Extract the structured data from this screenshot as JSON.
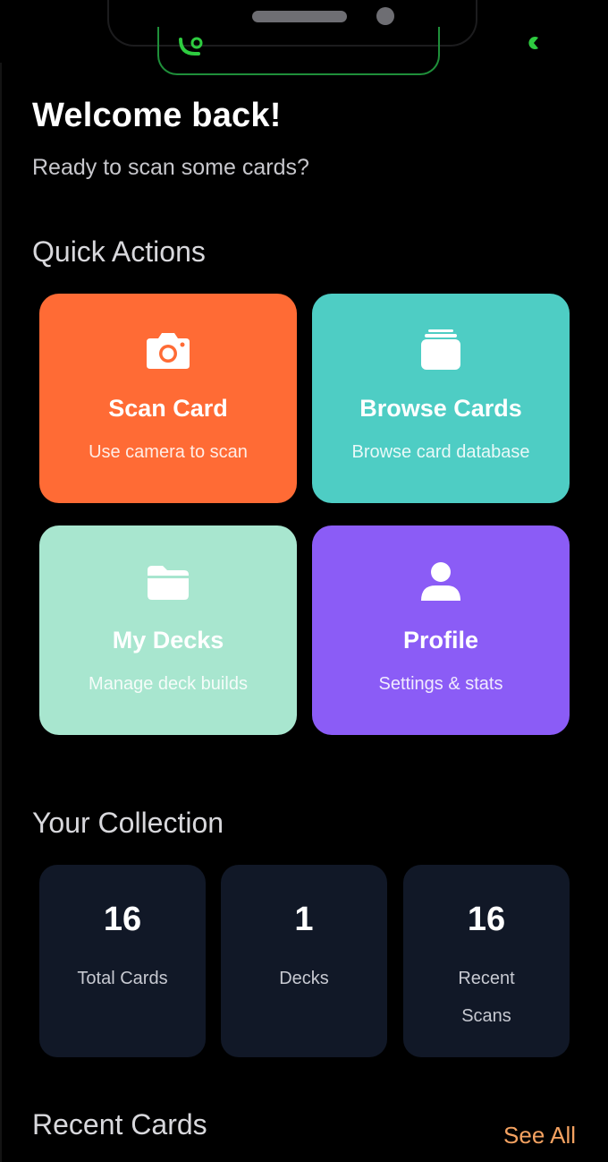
{
  "header": {
    "title": "Welcome back!",
    "subtitle": "Ready to scan some cards?"
  },
  "quick_actions": {
    "title": "Quick Actions",
    "tiles": [
      {
        "title": "Scan Card",
        "subtitle": "Use camera to scan",
        "icon": "camera-icon",
        "color": "#ff6b35"
      },
      {
        "title": "Browse Cards",
        "subtitle": "Browse card database",
        "icon": "card-stack-icon",
        "color": "#4ecdc4"
      },
      {
        "title": "My Decks",
        "subtitle": "Manage deck builds",
        "icon": "folder-icon",
        "color": "#a8e6cf"
      },
      {
        "title": "Profile",
        "subtitle": "Settings & stats",
        "icon": "person-icon",
        "color": "#8b5cf6"
      }
    ]
  },
  "collection": {
    "title": "Your Collection",
    "stats": [
      {
        "value": "16",
        "label": "Total Cards"
      },
      {
        "value": "1",
        "label": "Decks"
      },
      {
        "value": "16",
        "label": "Recent Scans"
      }
    ],
    "card_color": "#111827"
  },
  "recent": {
    "title": "Recent Cards",
    "see_all": "See All",
    "see_all_color": "#f4a261"
  }
}
